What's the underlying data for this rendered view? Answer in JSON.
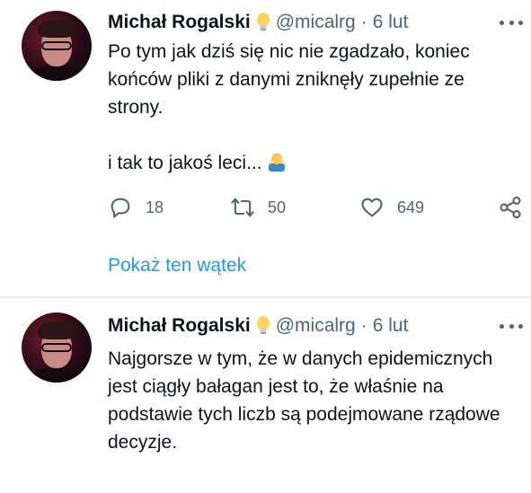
{
  "tweets": [
    {
      "author": {
        "name": "Michał Rogalski",
        "handle": "@micalrg"
      },
      "separator": "·",
      "date": "6 lut",
      "paragraphs": [
        "Po tym jak dziś się nic nie zgadzało, koniec końców pliki z danymi zniknęły zupełnie ze strony.",
        "i tak to jakoś leci..."
      ],
      "emoji": "man-shrugging-emoji",
      "actions": {
        "replies": "18",
        "retweets": "50",
        "likes": "649"
      },
      "show_thread": "Pokaż ten wątek"
    },
    {
      "author": {
        "name": "Michał Rogalski",
        "handle": "@micalrg"
      },
      "separator": "·",
      "date": "6 lut",
      "paragraphs": [
        "Najgorsze w tym, że w danych epidemicznych jest ciągły bałagan jest to, że właśnie na podstawie tych liczb są podejmowane rządowe decyzje."
      ]
    }
  ],
  "colors": {
    "link": "#1d9bf0",
    "secondary": "#536471",
    "text": "#0f1419"
  }
}
